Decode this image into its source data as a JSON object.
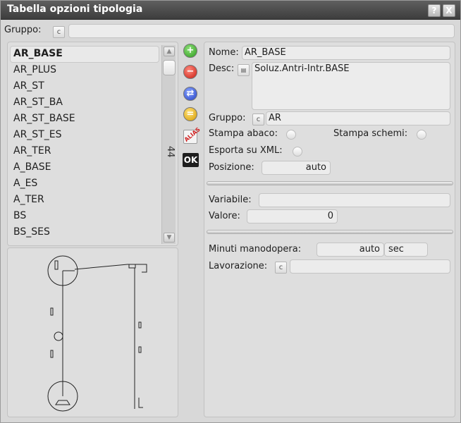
{
  "window": {
    "title": "Tabella opzioni tipologia",
    "help_label": "?",
    "close_label": "X"
  },
  "top": {
    "group_label": "Gruppo:",
    "group_btn": "c",
    "group_value": ""
  },
  "list": {
    "items": [
      "AR_BASE",
      "AR_PLUS",
      "AR_ST",
      "AR_ST_BA",
      "AR_ST_BASE",
      "AR_ST_ES",
      "AR_TER",
      "A_BASE",
      "A_ES",
      "A_TER",
      "BS",
      "BS_SES"
    ],
    "selected_index": 0,
    "count": "44",
    "scroll_up": "▲",
    "scroll_down": "▼"
  },
  "toolbar": {
    "add_icon": "+",
    "delete_icon": "−",
    "swap_icon": "⇄",
    "equal_icon": "=",
    "alias_label": "ALIAS",
    "ok_label": "OK"
  },
  "form": {
    "nome_label": "Nome:",
    "nome_value": "AR_BASE",
    "desc_label": "Desc:",
    "desc_value": "Soluz.Antri-Intr.BASE",
    "gruppo_label": "Gruppo:",
    "gruppo_btn": "c",
    "gruppo_value": "AR",
    "stampa_abaco_label": "Stampa abaco:",
    "stampa_schemi_label": "Stampa schemi:",
    "esporta_xml_label": "Esporta su XML:",
    "posizione_label": "Posizione:",
    "posizione_value": "auto",
    "variabile_label": "Variabile:",
    "variabile_value": "",
    "valore_label": "Valore:",
    "valore_value": "0",
    "minuti_label": "Minuti manodopera:",
    "minuti_value": "auto",
    "minuti_unit": "sec",
    "lavorazione_label": "Lavorazione:",
    "lavorazione_btn": "c",
    "lavorazione_value": ""
  }
}
